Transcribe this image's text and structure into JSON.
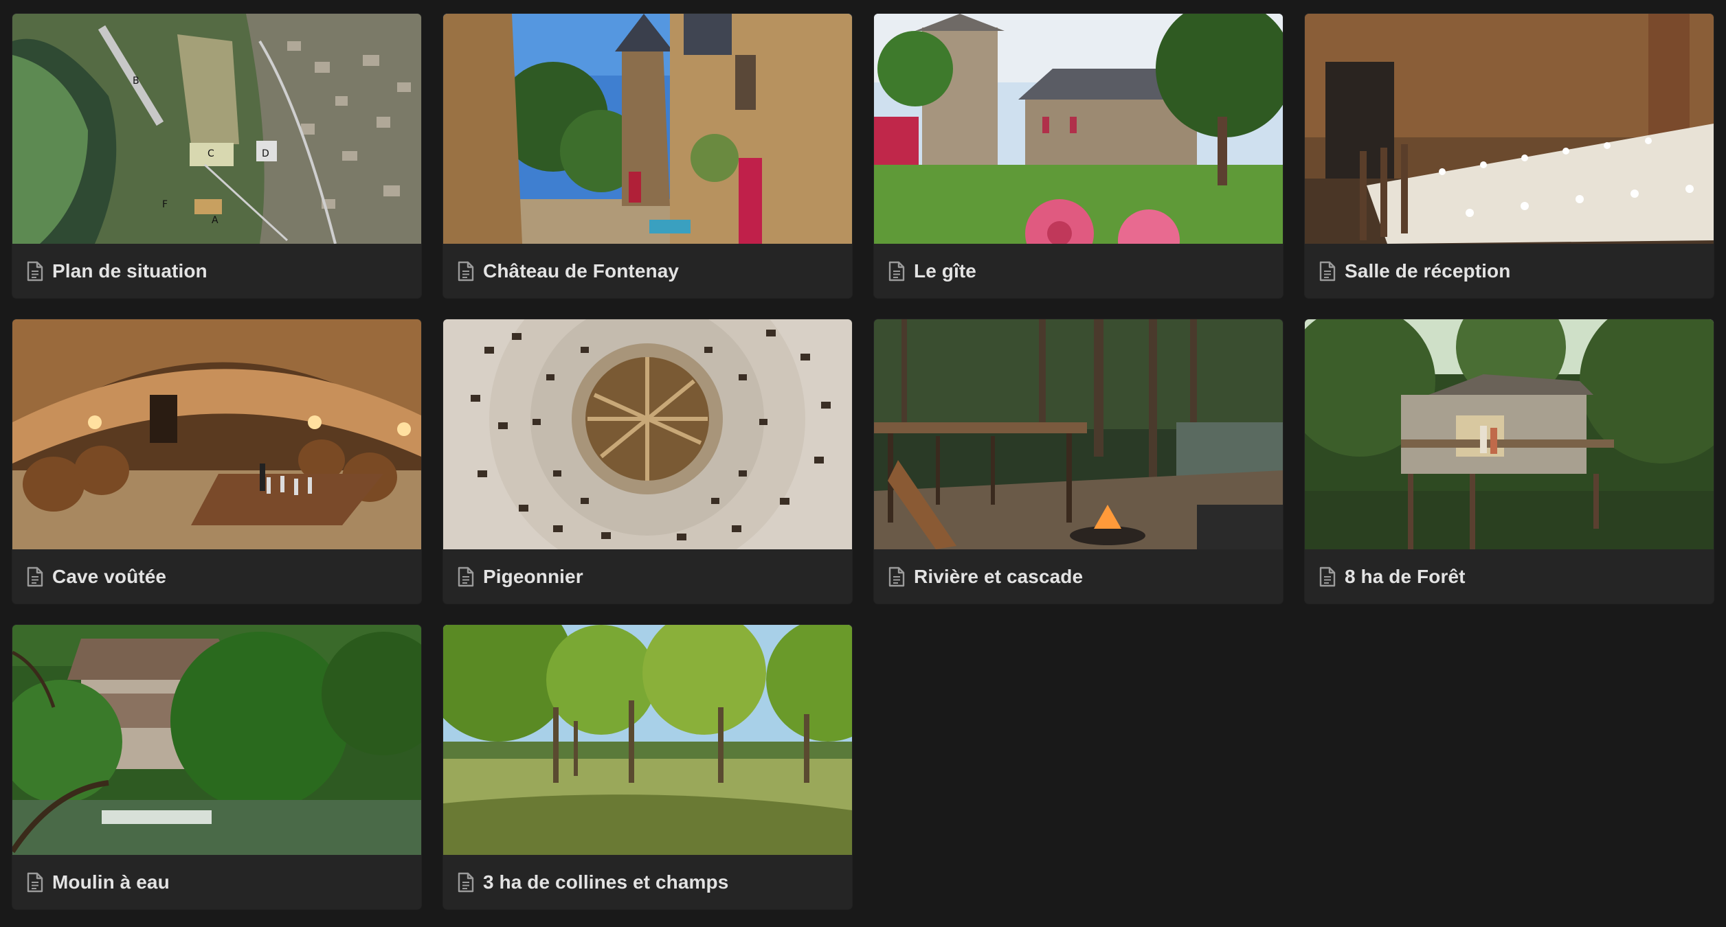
{
  "gallery": {
    "cards": [
      {
        "title": "Plan de situation",
        "map_labels": [
          "B",
          "C",
          "D",
          "F",
          "A"
        ]
      },
      {
        "title": "Château de Fontenay"
      },
      {
        "title": "Le gîte"
      },
      {
        "title": "Salle de réception"
      },
      {
        "title": "Cave voûtée"
      },
      {
        "title": "Pigeonnier"
      },
      {
        "title": "Rivière et cascade"
      },
      {
        "title": "8 ha de Forêt"
      },
      {
        "title": "Moulin à eau"
      },
      {
        "title": "3 ha de collines et champs"
      }
    ]
  },
  "icons": {
    "card_icon": "page-document-icon"
  },
  "colors": {
    "background": "#191919",
    "card": "#252525",
    "text": "#e3e3e3",
    "icon": "#9b9b9b"
  }
}
